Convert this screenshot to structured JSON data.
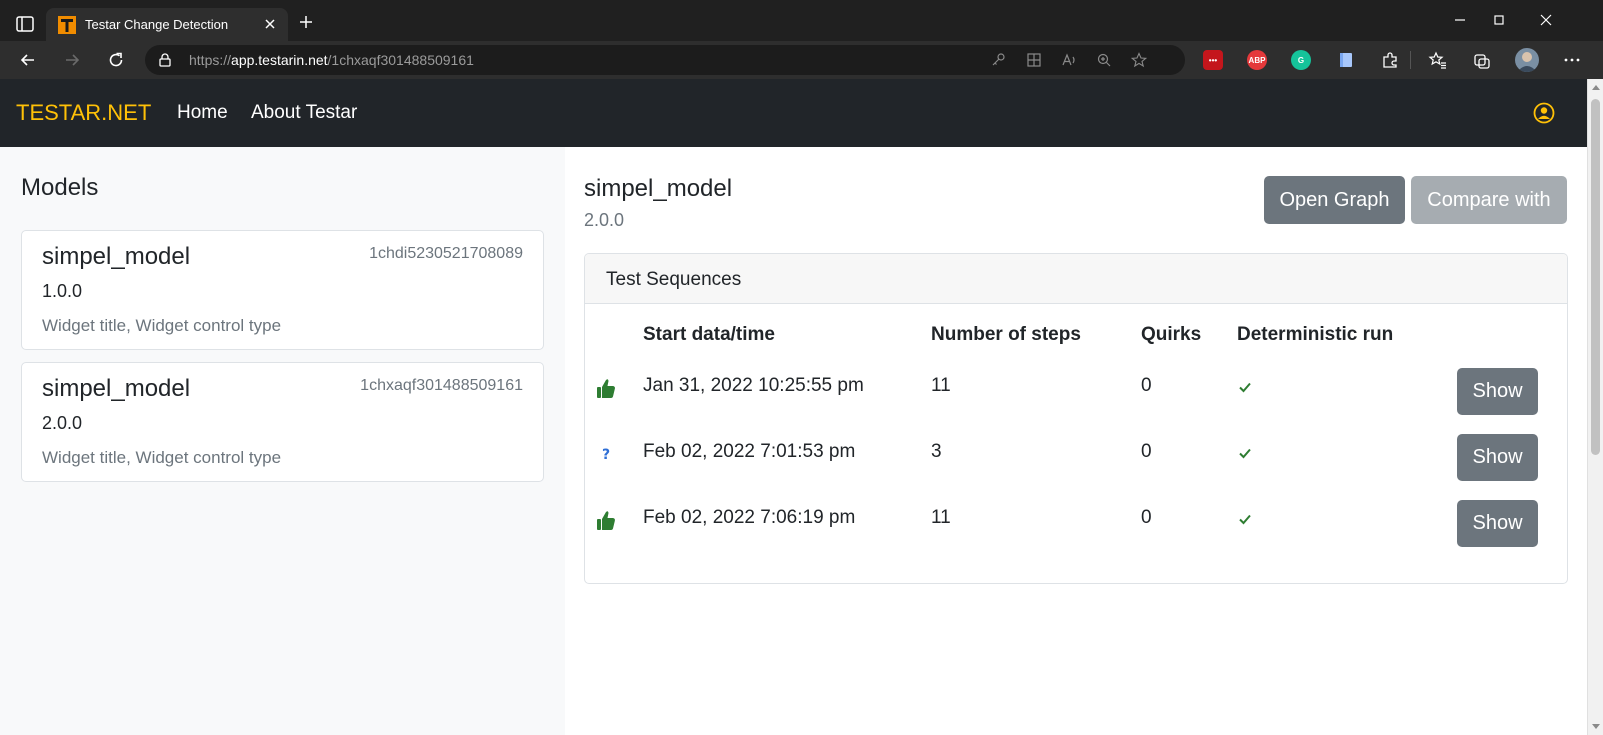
{
  "browser": {
    "tab_title": "Testar Change Detection",
    "url_prefix": "https://",
    "url_host": "app.testarin.net",
    "url_path": "/1chxaqf301488509161"
  },
  "colors": {
    "brand": "#ffc107",
    "navbar_bg": "#212529",
    "secondary_button": "#6c757d",
    "success_icon": "#2e7d32",
    "info_icon": "#2f6fd6"
  },
  "navbar": {
    "brand": "TESTAR.NET",
    "links": [
      {
        "label": "Home"
      },
      {
        "label": "About Testar"
      }
    ]
  },
  "sidebar": {
    "heading": "Models",
    "models": [
      {
        "name": "simpel_model",
        "id": "1chdi5230521708089",
        "version": "1.0.0",
        "attributes": "Widget title, Widget control type"
      },
      {
        "name": "simpel_model",
        "id": "1chxaqf301488509161",
        "version": "2.0.0",
        "attributes": "Widget title, Widget control type"
      }
    ]
  },
  "main": {
    "title": "simpel_model",
    "version": "2.0.0",
    "open_graph_label": "Open Graph",
    "compare_label": "Compare with"
  },
  "sequences": {
    "heading": "Test Sequences",
    "columns": [
      "Start data/time",
      "Number of steps",
      "Quirks",
      "Deterministic run"
    ],
    "rows": [
      {
        "status_icon": "thumbs-up-icon",
        "start": "Jan 31, 2022 10:25:55 pm",
        "steps": "11",
        "quirks": "0",
        "deterministic": "check-icon",
        "action": "Show"
      },
      {
        "status_icon": "question-icon",
        "start": "Feb 02, 2022 7:01:53 pm",
        "steps": "3",
        "quirks": "0",
        "deterministic": "check-icon",
        "action": "Show"
      },
      {
        "status_icon": "thumbs-up-icon",
        "start": "Feb 02, 2022 7:06:19 pm",
        "steps": "11",
        "quirks": "0",
        "deterministic": "check-icon",
        "action": "Show"
      }
    ]
  }
}
